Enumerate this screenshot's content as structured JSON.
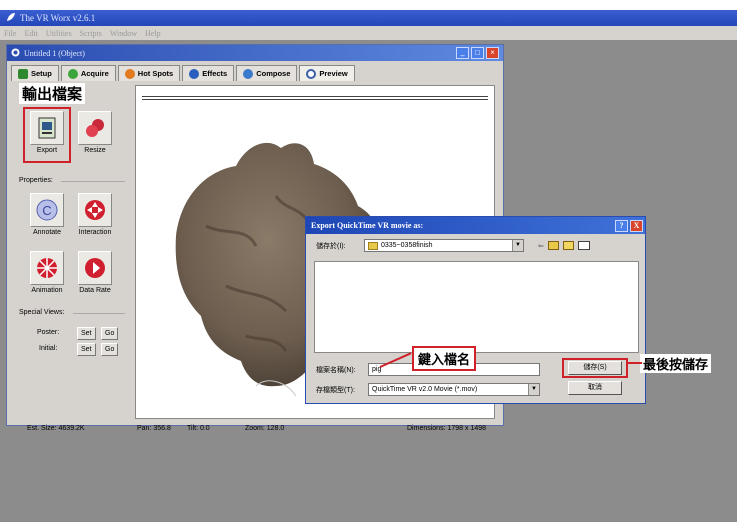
{
  "app": {
    "title": "The VR Worx v2.6.1",
    "menu": [
      "File",
      "Edit",
      "Utilities",
      "Scripts",
      "Window",
      "Help"
    ]
  },
  "document": {
    "title": "Untitled 1 (Object)",
    "tabs": [
      "Setup",
      "Acquire",
      "Hot Spots",
      "Effects",
      "Compose",
      "Preview"
    ],
    "active_tab": "Preview"
  },
  "annotations": {
    "export_output": "輸出檔案",
    "enter_filename": "鍵入檔名",
    "finally_save": "最後按儲存"
  },
  "tools": {
    "export": "Export",
    "resize": "Resize",
    "properties_label": "Properties:",
    "annotate": "Annotate",
    "interaction": "Interaction",
    "animation": "Animation",
    "data_rate": "Data Rate",
    "special_views_label": "Special Views:",
    "poster_label": "Poster:",
    "initial_label": "Initial:",
    "set": "Set",
    "go": "Go"
  },
  "status": {
    "est_size": "Est. Size: 4639.2K",
    "pan": "Pan: 356.8",
    "tilt": "Tilt: 0.0",
    "zoom": "Zoom: 128.0",
    "dimensions": "Dimensions: 1798 x 1498"
  },
  "dialog": {
    "title": "Export QuickTime VR movie as:",
    "save_in_label": "儲存於(I):",
    "save_in_value": "0335~0358finish",
    "filename_label": "檔案名稱(N):",
    "filename_value": "pig",
    "filetype_label": "存檔類型(T):",
    "filetype_value": "QuickTime VR v2.0 Movie (*.mov)",
    "save_button": "儲存(S)",
    "cancel_button": "取消",
    "help_button": "?",
    "close_button": "X"
  },
  "colors": {
    "accent_red": "#d0202a",
    "titlebar_blue": "#2a4cb0",
    "workspace_gray": "#8c8c8c"
  }
}
